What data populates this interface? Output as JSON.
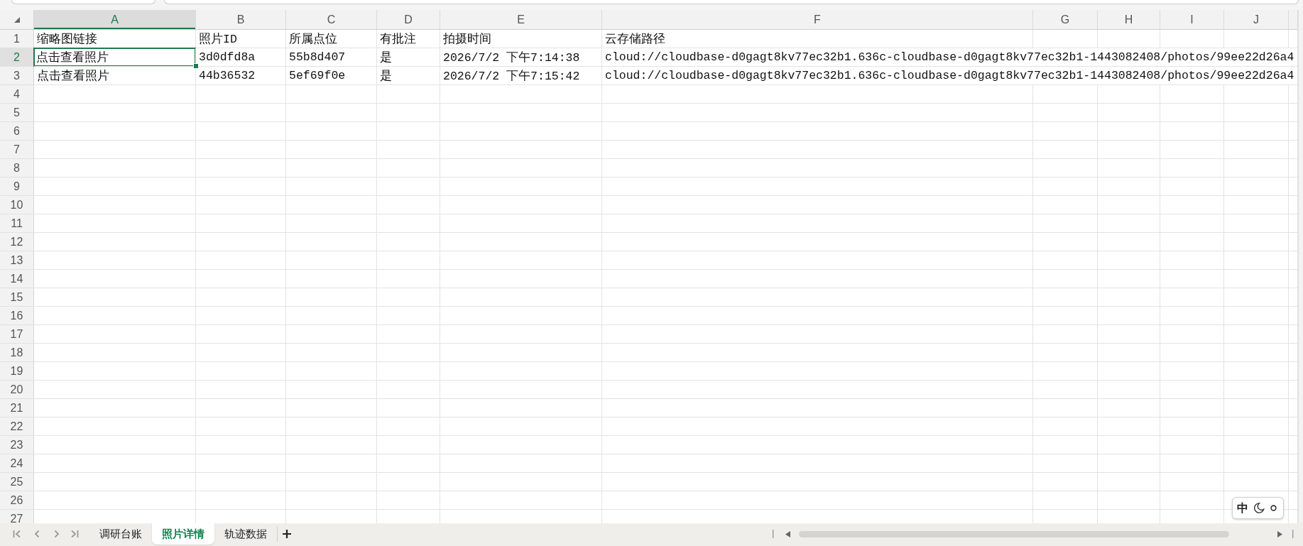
{
  "sheet": {
    "columns": [
      {
        "label": "A",
        "selected": true
      },
      {
        "label": "B",
        "selected": false
      },
      {
        "label": "C",
        "selected": false
      },
      {
        "label": "D",
        "selected": false
      },
      {
        "label": "E",
        "selected": false
      },
      {
        "label": "F",
        "selected": false
      },
      {
        "label": "G",
        "selected": false
      },
      {
        "label": "H",
        "selected": false
      },
      {
        "label": "I",
        "selected": false
      },
      {
        "label": "J",
        "selected": false
      }
    ],
    "rows": [
      {
        "number": "1",
        "selected": false,
        "cells": [
          "缩略图链接",
          "照片ID",
          "所属点位",
          "有批注",
          "拍摄时间",
          "云存储路径"
        ]
      },
      {
        "number": "2",
        "selected": true,
        "cells": [
          "点击查看照片",
          "3d0dfd8a",
          "55b8d407",
          "是",
          "2026/7/2 下午7:14:38",
          "cloud://cloudbase-d0gagt8kv77ec32b1.636c-cloudbase-d0gagt8kv77ec32b1-1443082408/photos/99ee22d26a4"
        ]
      },
      {
        "number": "3",
        "selected": false,
        "cells": [
          "点击查看照片",
          "44b36532",
          "5ef69f0e",
          "是",
          "2026/7/2 下午7:15:42",
          "cloud://cloudbase-d0gagt8kv77ec32b1.636c-cloudbase-d0gagt8kv77ec32b1-1443082408/photos/99ee22d26a4"
        ]
      },
      {
        "number": "4",
        "selected": false
      },
      {
        "number": "5",
        "selected": false
      },
      {
        "number": "6",
        "selected": false
      },
      {
        "number": "7",
        "selected": false
      },
      {
        "number": "8",
        "selected": false
      },
      {
        "number": "9",
        "selected": false
      },
      {
        "number": "10",
        "selected": false
      },
      {
        "number": "11",
        "selected": false
      },
      {
        "number": "12",
        "selected": false
      },
      {
        "number": "13",
        "selected": false
      },
      {
        "number": "14",
        "selected": false
      },
      {
        "number": "15",
        "selected": false
      },
      {
        "number": "16",
        "selected": false
      },
      {
        "number": "17",
        "selected": false
      },
      {
        "number": "18",
        "selected": false
      },
      {
        "number": "19",
        "selected": false
      },
      {
        "number": "20",
        "selected": false
      },
      {
        "number": "21",
        "selected": false
      },
      {
        "number": "22",
        "selected": false
      },
      {
        "number": "23",
        "selected": false
      },
      {
        "number": "24",
        "selected": false
      },
      {
        "number": "25",
        "selected": false
      },
      {
        "number": "26",
        "selected": false
      },
      {
        "number": "27",
        "selected": false
      }
    ]
  },
  "sheet_tabs": [
    {
      "label": "调研台账",
      "selected": false
    },
    {
      "label": "照片详情",
      "selected": true
    },
    {
      "label": "轨迹数据",
      "selected": false
    }
  ],
  "input_method": {
    "mode": "中"
  }
}
